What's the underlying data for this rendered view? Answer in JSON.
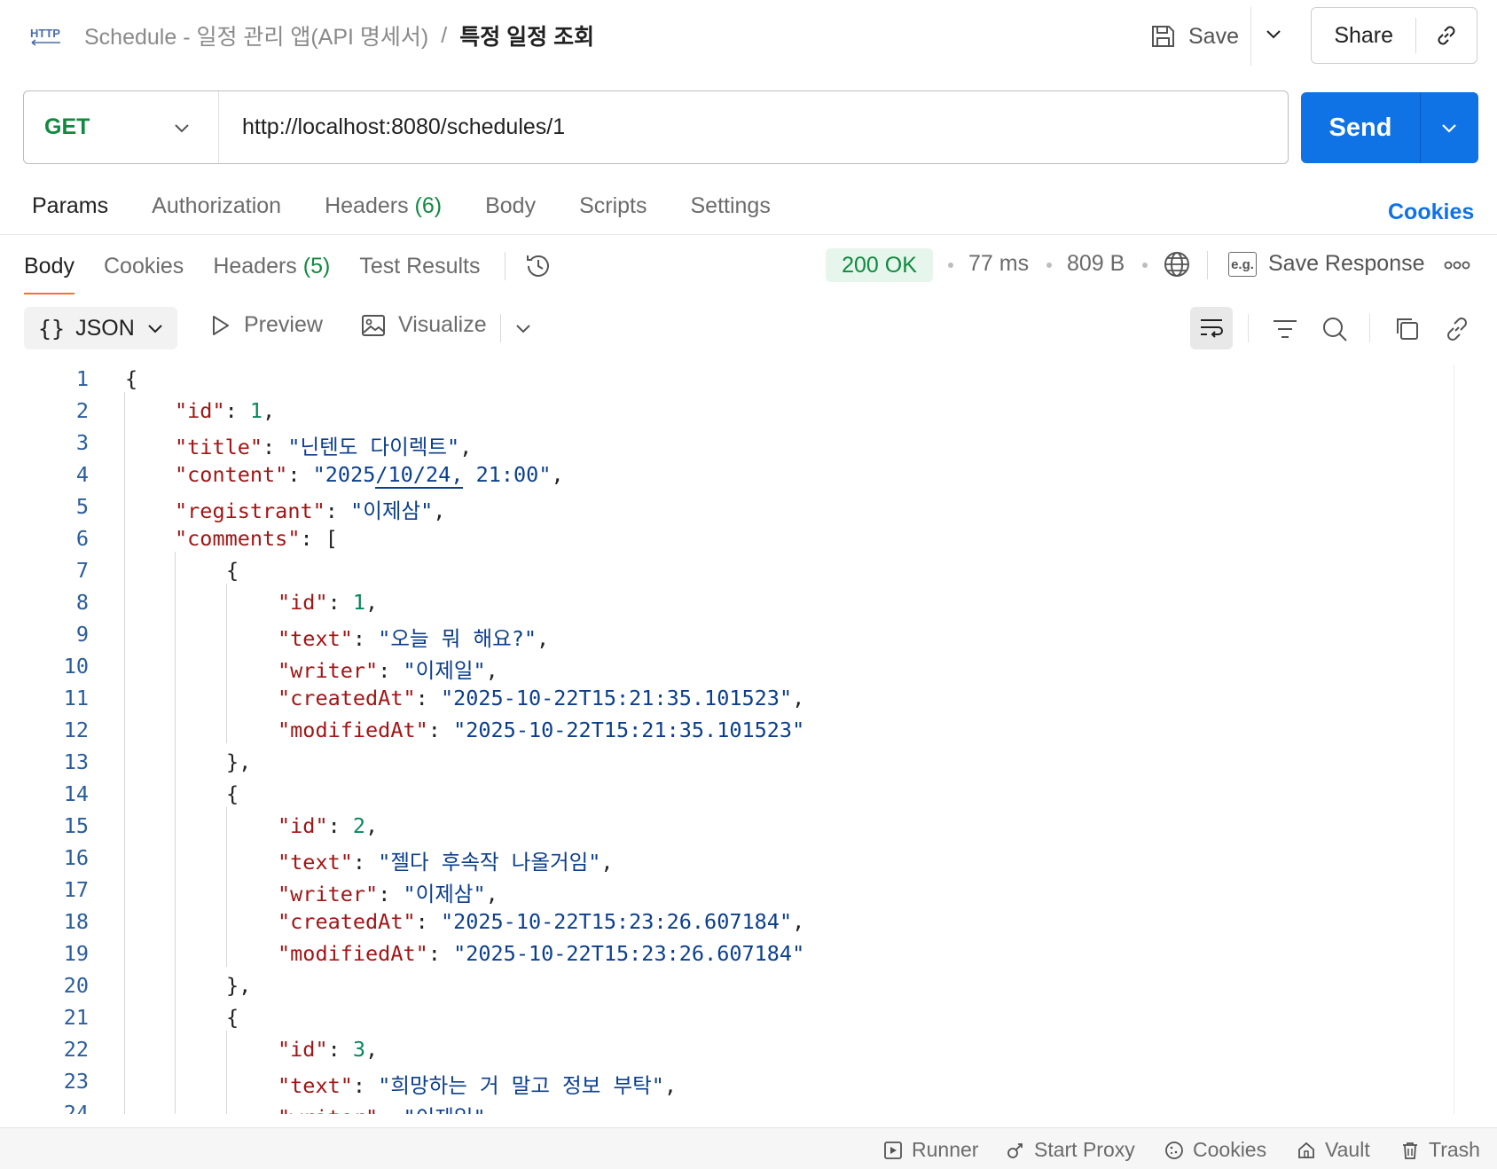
{
  "header": {
    "icon_label": "HTTP",
    "breadcrumb_parent": "Schedule - 일정 관리 앱(API 명세서)",
    "breadcrumb_sep": "/",
    "breadcrumb_current": "특정 일정 조회",
    "save_label": "Save",
    "share_label": "Share"
  },
  "request": {
    "method": "GET",
    "url": "http://localhost:8080/schedules/1",
    "send_label": "Send"
  },
  "request_tabs": {
    "params": "Params",
    "authorization": "Authorization",
    "headers": "Headers",
    "headers_count": "(6)",
    "body": "Body",
    "scripts": "Scripts",
    "settings": "Settings",
    "cookies": "Cookies"
  },
  "response_tabs": {
    "body": "Body",
    "cookies": "Cookies",
    "headers": "Headers",
    "headers_count": "(5)",
    "test_results": "Test Results"
  },
  "response_meta": {
    "status": "200 OK",
    "time": "77 ms",
    "size": "809 B",
    "save_response": "Save Response",
    "eg_label": "e.g."
  },
  "body_toolbar": {
    "format_braces": "{}",
    "format": "JSON",
    "preview": "Preview",
    "visualize": "Visualize"
  },
  "code": {
    "l1": "{",
    "l2_key": "\"id\"",
    "l2_val": "1",
    "l3_key": "\"title\"",
    "l3_val": "\"닌텐도 다이렉트\"",
    "l4_key": "\"content\"",
    "l4_val_a": "\"2025",
    "l4_val_b": "/10/24,",
    "l4_val_c": " 21:00\"",
    "l5_key": "\"registrant\"",
    "l5_val": "\"이제삼\"",
    "l6_key": "\"comments\"",
    "l6_val": "[",
    "c1_id": "1",
    "c1_text": "\"오늘 뭐 해요?\"",
    "c1_writer": "\"이제일\"",
    "c1_created": "\"2025-10-22T15:21:35.101523\"",
    "c1_modified": "\"2025-10-22T15:21:35.101523\"",
    "c2_id": "2",
    "c2_text": "\"젤다 후속작 나올거임\"",
    "c2_writer": "\"이제삼\"",
    "c2_created": "\"2025-10-22T15:23:26.607184\"",
    "c2_modified": "\"2025-10-22T15:23:26.607184\"",
    "c3_id": "3",
    "c3_text": "\"희망하는 거 말고 정보 부탁\"",
    "c3_writer": "\"이제일\"",
    "key_id": "\"id\"",
    "key_text": "\"text\"",
    "key_writer": "\"writer\"",
    "key_created": "\"createdAt\"",
    "key_modified": "\"modifiedAt\"",
    "open_brace": "{",
    "close_brace": "},"
  },
  "footer": {
    "runner": "Runner",
    "start_proxy": "Start Proxy",
    "cookies": "Cookies",
    "vault": "Vault",
    "trash": "Trash"
  }
}
